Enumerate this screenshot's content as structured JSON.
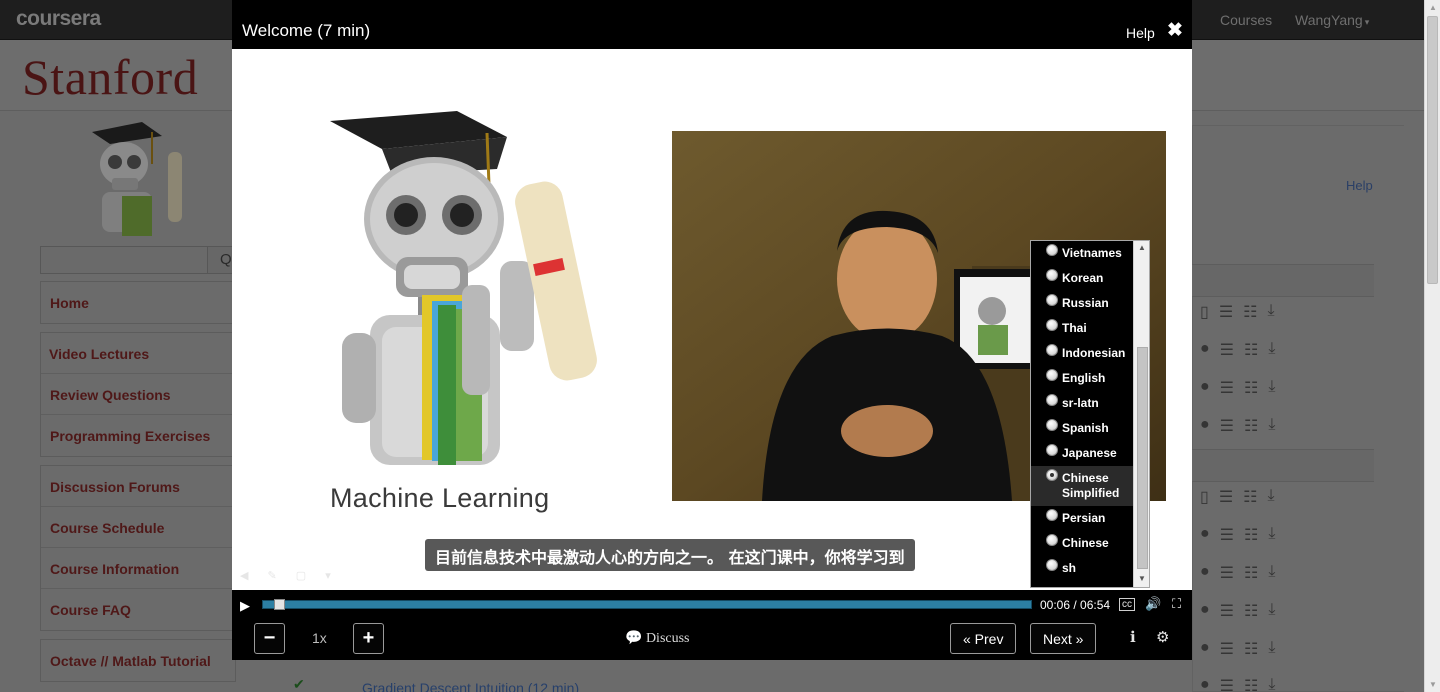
{
  "topbar": {
    "logo": "coursera",
    "courses": "Courses",
    "user": "WangYang",
    "user_caret": "▾"
  },
  "brand": {
    "stanford": "Stanford"
  },
  "sidebar": {
    "search_icon": "search-icon",
    "groups": [
      [
        "Home"
      ],
      [
        "Video Lectures",
        "Review Questions",
        "Programming Exercises"
      ],
      [
        "Discussion Forums",
        "Course Schedule",
        "Course Information",
        "Course FAQ"
      ],
      [
        "Octave // Matlab Tutorial"
      ]
    ]
  },
  "background": {
    "help": "Help",
    "partial_lecture": "Gradient Descent Intuition (12 min)"
  },
  "modal": {
    "title": "Welcome (7 min)",
    "help": "Help",
    "close_icon": "✖",
    "slide_title": "Machine Learning",
    "subtitle": "目前信息技术中最激动人心的方向之一。 在这门课中，你将学习到",
    "languages": [
      {
        "label": "Vietnames",
        "checked": false
      },
      {
        "label": "Korean",
        "checked": false
      },
      {
        "label": "Russian",
        "checked": false
      },
      {
        "label": "Thai",
        "checked": false
      },
      {
        "label": "Indonesian",
        "checked": false
      },
      {
        "label": "English",
        "checked": false
      },
      {
        "label": "sr-latn",
        "checked": false
      },
      {
        "label": "Spanish",
        "checked": false
      },
      {
        "label": "Japanese",
        "checked": false
      },
      {
        "label": "Chinese Simplified",
        "checked": true
      },
      {
        "label": "Persian",
        "checked": false
      },
      {
        "label": "Chinese",
        "checked": false
      },
      {
        "label": "sh",
        "checked": false
      }
    ],
    "player": {
      "time": "00:06 / 06:54",
      "progress_fraction": 0.014,
      "speed": "1x",
      "minus": "−",
      "plus": "+",
      "discuss": "Discuss",
      "prev": "« Prev",
      "next": "Next »"
    }
  },
  "colors": {
    "progress": "#2c7fa3",
    "nav_text": "#4f1818",
    "modal_bg": "#000000"
  }
}
